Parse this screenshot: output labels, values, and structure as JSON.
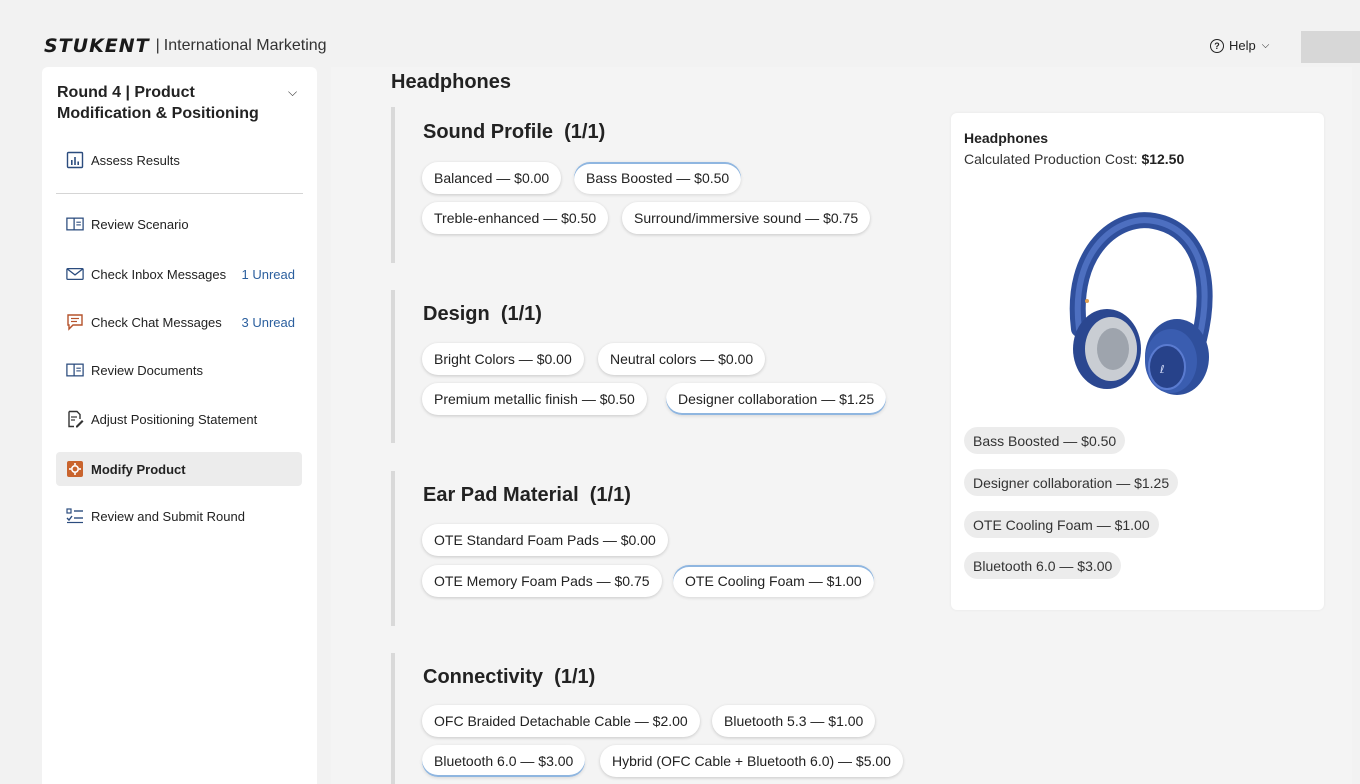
{
  "header": {
    "logo": "STUKENT",
    "separator": "|",
    "course": "International Marketing",
    "help_label": "Help"
  },
  "sidebar": {
    "round_title": "Round 4 | Product Modification & Positioning",
    "items": [
      {
        "label": "Assess Results",
        "icon": "chart-icon"
      },
      {
        "label": "Review Scenario",
        "icon": "document-icon"
      },
      {
        "label": "Check Inbox Messages",
        "icon": "envelope-icon",
        "badge": "1 Unread"
      },
      {
        "label": "Check Chat Messages",
        "icon": "chat-icon",
        "badge": "3 Unread"
      },
      {
        "label": "Review Documents",
        "icon": "document-icon"
      },
      {
        "label": "Adjust Positioning Statement",
        "icon": "edit-document-icon"
      },
      {
        "label": "Modify Product",
        "icon": "gear-icon",
        "active": true
      },
      {
        "label": "Review and Submit Round",
        "icon": "checklist-icon"
      }
    ]
  },
  "main": {
    "section_title": "Headphones",
    "groups": [
      {
        "title": "Sound Profile",
        "count": "(1/1)",
        "options": [
          "Balanced — $0.00",
          "Bass Boosted — $0.50",
          "Treble-enhanced — $0.50",
          "Surround/immersive sound — $0.75"
        ],
        "selected": "Bass Boosted — $0.50"
      },
      {
        "title": "Design",
        "count": "(1/1)",
        "options": [
          "Bright Colors — $0.00",
          "Neutral colors — $0.00",
          "Premium metallic finish — $0.50",
          "Designer collaboration — $1.25"
        ],
        "selected": "Designer collaboration — $1.25"
      },
      {
        "title": "Ear Pad Material",
        "count": "(1/1)",
        "options": [
          "OTE Standard Foam Pads — $0.00",
          "OTE Memory Foam Pads — $0.75",
          "OTE Cooling Foam — $1.00"
        ],
        "selected": "OTE Cooling Foam — $1.00"
      },
      {
        "title": "Connectivity",
        "count": "(1/1)",
        "options": [
          "OFC Braided Detachable Cable — $2.00",
          "Bluetooth 5.3 — $1.00",
          "Bluetooth 6.0 — $3.00",
          "Hybrid (OFC Cable + Bluetooth 6.0) — $5.00"
        ],
        "selected": "Bluetooth 6.0 — $3.00"
      }
    ]
  },
  "summary": {
    "title": "Headphones",
    "cost_label": "Calculated Production Cost:",
    "cost_value": "$12.50",
    "image": "headphones-illustration",
    "selections": [
      "Bass Boosted — $0.50",
      "Designer collaboration — $1.25",
      "OTE Cooling Foam — $1.00",
      "Bluetooth 6.0 — $3.00"
    ]
  },
  "colors": {
    "accent": "#2b5f9e",
    "headphone_blue": "#3557a6",
    "selected_underline": "#8fb6e0"
  }
}
